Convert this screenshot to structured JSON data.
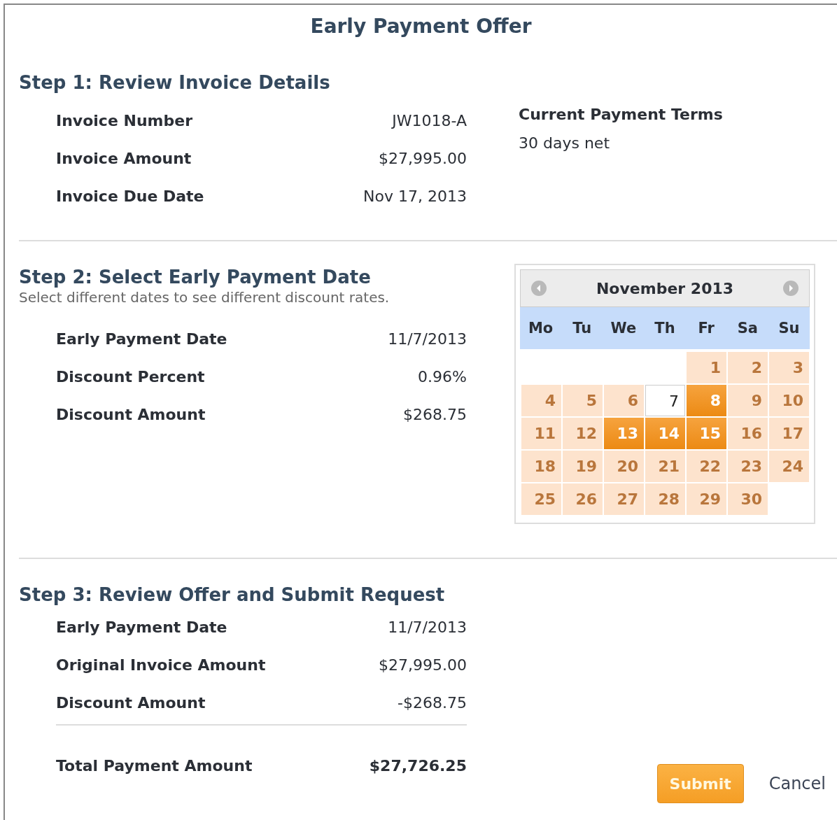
{
  "dialog": {
    "title": "Early Payment Offer"
  },
  "step1": {
    "heading": "Step 1: Review Invoice Details",
    "rows": [
      {
        "label": "Invoice Number",
        "value": "JW1018-A"
      },
      {
        "label": "Invoice Amount",
        "value": "$27,995.00"
      },
      {
        "label": "Invoice Due Date",
        "value": "Nov 17, 2013"
      }
    ],
    "terms": {
      "label": "Current Payment Terms",
      "value": "30 days net"
    }
  },
  "step2": {
    "heading": "Step 2: Select Early Payment Date",
    "hint": "Select different dates to see different discount rates.",
    "rows": [
      {
        "label": "Early Payment Date",
        "value": "11/7/2013"
      },
      {
        "label": "Discount Percent",
        "value": "0.96%"
      },
      {
        "label": "Discount Amount",
        "value": "$268.75"
      }
    ],
    "calendar": {
      "month": "November 2013",
      "weekdays": [
        "Mo",
        "Tu",
        "We",
        "Th",
        "Fr",
        "Sa",
        "Su"
      ],
      "weeks": [
        [
          {
            "day": "1",
            "kind": "unavailable",
            "selected": false
          },
          {
            "day": "2",
            "kind": "unavailable",
            "selected": false
          },
          {
            "day": "3",
            "kind": "unavailable",
            "selected": false
          }
        ],
        [
          {
            "day": "4",
            "kind": "unavailable",
            "selected": false
          },
          {
            "day": "5",
            "kind": "unavailable",
            "selected": false
          },
          {
            "day": "6",
            "kind": "unavailable",
            "selected": false
          },
          {
            "day": "7",
            "kind": "available",
            "selected": true
          },
          {
            "day": "8",
            "kind": "available",
            "selected": false
          },
          {
            "day": "9",
            "kind": "unavailable",
            "selected": false
          },
          {
            "day": "10",
            "kind": "unavailable",
            "selected": false
          }
        ],
        [
          {
            "day": "11",
            "kind": "unavailable",
            "selected": false
          },
          {
            "day": "12",
            "kind": "unavailable",
            "selected": false
          },
          {
            "day": "13",
            "kind": "available",
            "selected": false
          },
          {
            "day": "14",
            "kind": "available",
            "selected": false
          },
          {
            "day": "15",
            "kind": "available",
            "selected": false
          },
          {
            "day": "16",
            "kind": "unavailable",
            "selected": false
          },
          {
            "day": "17",
            "kind": "unavailable",
            "selected": false
          }
        ],
        [
          {
            "day": "18",
            "kind": "unavailable",
            "selected": false
          },
          {
            "day": "19",
            "kind": "unavailable",
            "selected": false
          },
          {
            "day": "20",
            "kind": "unavailable",
            "selected": false
          },
          {
            "day": "21",
            "kind": "unavailable",
            "selected": false
          },
          {
            "day": "22",
            "kind": "unavailable",
            "selected": false
          },
          {
            "day": "23",
            "kind": "unavailable",
            "selected": false
          },
          {
            "day": "24",
            "kind": "unavailable",
            "selected": false
          }
        ],
        [
          {
            "day": "25",
            "kind": "unavailable",
            "selected": false
          },
          {
            "day": "26",
            "kind": "unavailable",
            "selected": false
          },
          {
            "day": "27",
            "kind": "unavailable",
            "selected": false
          },
          {
            "day": "28",
            "kind": "unavailable",
            "selected": false
          },
          {
            "day": "29",
            "kind": "unavailable",
            "selected": false
          },
          {
            "day": "30",
            "kind": "unavailable",
            "selected": false
          }
        ]
      ]
    }
  },
  "step3": {
    "heading": "Step 3: Review Offer and Submit Request",
    "rows": [
      {
        "label": "Early Payment Date",
        "value": "11/7/2013"
      },
      {
        "label": "Original Invoice Amount",
        "value": "$27,995.00"
      },
      {
        "label": "Discount Amount",
        "value": "-$268.75"
      }
    ],
    "total": {
      "label": "Total Payment Amount",
      "value": "$27,726.25"
    }
  },
  "buttons": {
    "submit": "Submit",
    "cancel": "Cancel"
  }
}
